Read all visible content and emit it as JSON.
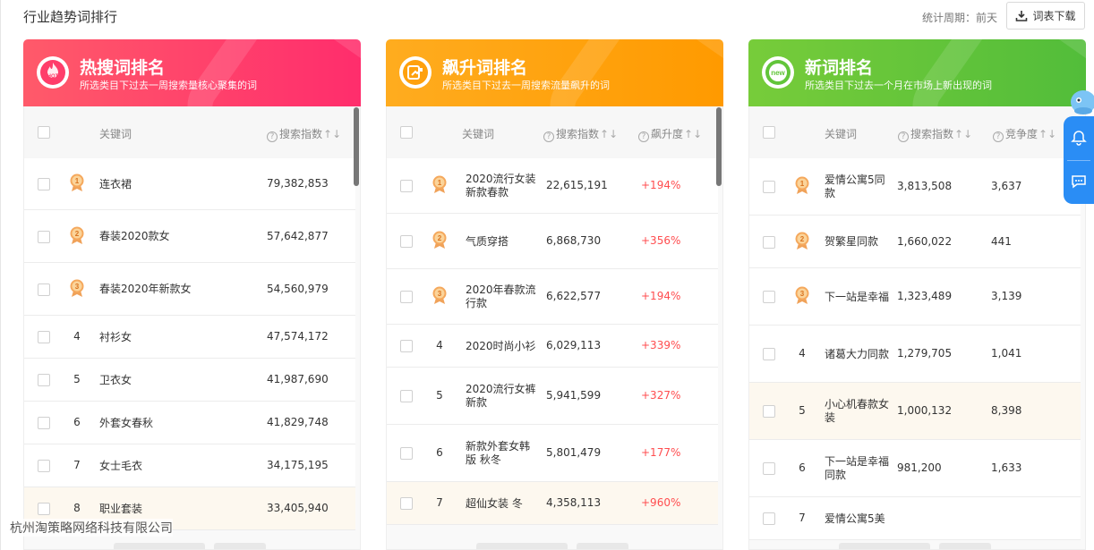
{
  "header": {
    "title": "行业趋势词排行",
    "period": "统计周期：前天",
    "download_label": "词表下载"
  },
  "footer_text": "杭州淘策略网络科技有限公司",
  "colors": {
    "red": "#ff3d6a",
    "orange": "#ffa10d",
    "green": "#62c53a",
    "rise": "#ff4d4f",
    "accent_blue": "#2a8df5"
  },
  "cards": [
    {
      "title": "热搜词排名",
      "subtitle": "所选类目下过去一周搜索量核心聚集的词",
      "icon_text": "HOT",
      "columns": [
        "关键词",
        "搜索指数"
      ],
      "rows": [
        {
          "rank": "1",
          "keyword": "连衣裙",
          "search_index": "79,382,853"
        },
        {
          "rank": "2",
          "keyword": "春装2020款女",
          "search_index": "57,642,877"
        },
        {
          "rank": "3",
          "keyword": "春装2020年新款女",
          "search_index": "54,560,979"
        },
        {
          "rank": "4",
          "keyword": "衬衫女",
          "search_index": "47,574,172"
        },
        {
          "rank": "5",
          "keyword": "卫衣女",
          "search_index": "41,987,690"
        },
        {
          "rank": "6",
          "keyword": "外套女春秋",
          "search_index": "41,829,748"
        },
        {
          "rank": "7",
          "keyword": "女士毛衣",
          "search_index": "34,175,195"
        },
        {
          "rank": "8",
          "keyword": "职业套装",
          "search_index": "33,405,940"
        }
      ]
    },
    {
      "title": "飙升词排名",
      "subtitle": "所选类目下过去一周搜索流量飙升的词",
      "columns": [
        "关键词",
        "搜索指数",
        "飙升度"
      ],
      "rows": [
        {
          "rank": "1",
          "keyword": "2020流行女装新款春款",
          "search_index": "22,615,191",
          "value": "+194%"
        },
        {
          "rank": "2",
          "keyword": "气质穿搭",
          "search_index": "6,868,730",
          "value": "+356%"
        },
        {
          "rank": "3",
          "keyword": "2020年春款流行款",
          "search_index": "6,622,577",
          "value": "+194%"
        },
        {
          "rank": "4",
          "keyword": "2020时尚小衫",
          "search_index": "6,029,113",
          "value": "+339%"
        },
        {
          "rank": "5",
          "keyword": "2020流行女裤新款",
          "search_index": "5,941,599",
          "value": "+327%"
        },
        {
          "rank": "6",
          "keyword": "新款外套女韩版 秋冬",
          "search_index": "5,801,479",
          "value": "+177%"
        },
        {
          "rank": "7",
          "keyword": "超仙女装 冬",
          "search_index": "4,358,113",
          "value": "+960%"
        }
      ]
    },
    {
      "title": "新词排名",
      "subtitle": "所选类目下过去一个月在市场上新出现的词",
      "icon_text": "new",
      "columns": [
        "关键词",
        "搜索指数",
        "竞争度"
      ],
      "rows": [
        {
          "rank": "1",
          "keyword": "爱情公寓5同款",
          "search_index": "3,813,508",
          "value": "3,637"
        },
        {
          "rank": "2",
          "keyword": "贺繁星同款",
          "search_index": "1,660,022",
          "value": "441"
        },
        {
          "rank": "3",
          "keyword": "下一站是幸福",
          "search_index": "1,323,489",
          "value": "3,139"
        },
        {
          "rank": "4",
          "keyword": "诸葛大力同款",
          "search_index": "1,279,705",
          "value": "1,041"
        },
        {
          "rank": "5",
          "keyword": "小心机春款女装",
          "search_index": "1,000,132",
          "value": "8,398"
        },
        {
          "rank": "6",
          "keyword": "下一站是幸福同款",
          "search_index": "981,200",
          "value": "1,633"
        },
        {
          "rank": "7",
          "keyword": "爱情公寓5美",
          "search_index": "",
          "value": ""
        }
      ]
    }
  ]
}
